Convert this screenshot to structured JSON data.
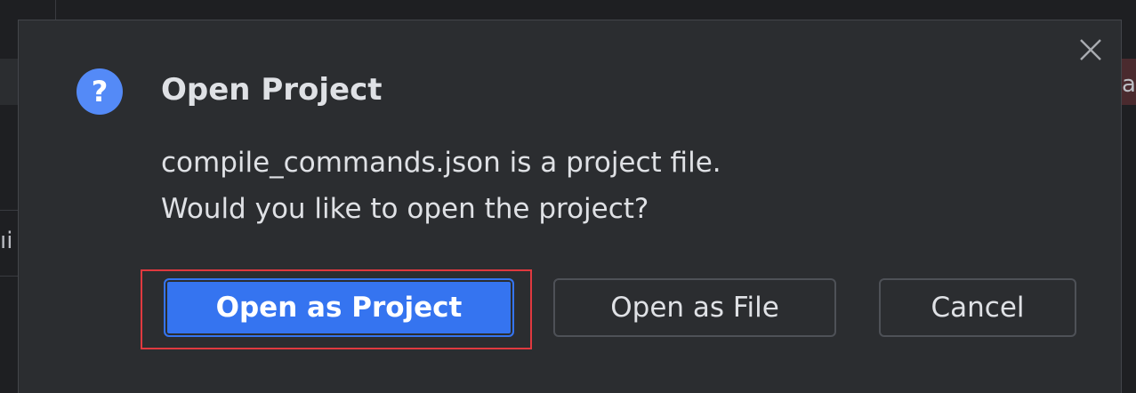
{
  "dialog": {
    "title": "Open Project",
    "message_line1": "compile_commands.json is a project file.",
    "message_line2": "Would you like to open the project?",
    "icon": "question-icon",
    "close_icon": "close-icon"
  },
  "buttons": {
    "open_as_project": "Open as Project",
    "open_as_file": "Open as File",
    "cancel": "Cancel"
  },
  "background": {
    "right_glyph": "a",
    "left_glyph": "ıi"
  },
  "colors": {
    "dialog_bg": "#2b2d30",
    "primary": "#3574f0",
    "highlight": "#e0393f",
    "text": "#dfe1e5"
  }
}
